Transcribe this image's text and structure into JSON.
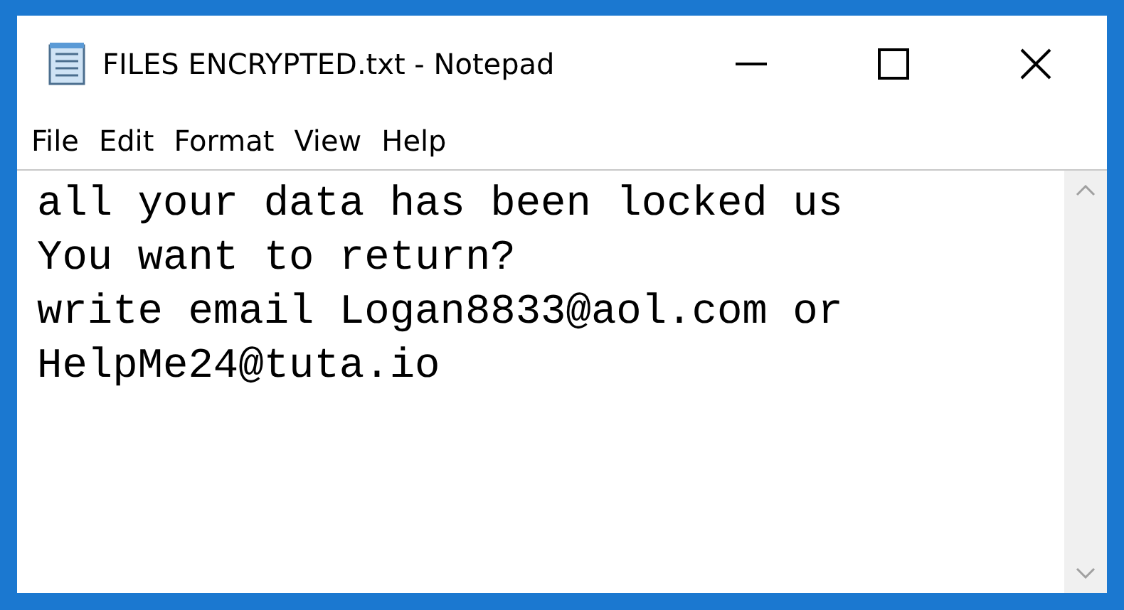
{
  "window": {
    "title": "FILES ENCRYPTED.txt - Notepad"
  },
  "menu": [
    {
      "label": "File"
    },
    {
      "label": "Edit"
    },
    {
      "label": "Format"
    },
    {
      "label": "View"
    },
    {
      "label": "Help"
    }
  ],
  "document": {
    "lines": [
      "all your data has been locked us",
      "You want to return?",
      "write email Logan8833@aol.com or",
      "HelpMe24@tuta.io"
    ]
  }
}
